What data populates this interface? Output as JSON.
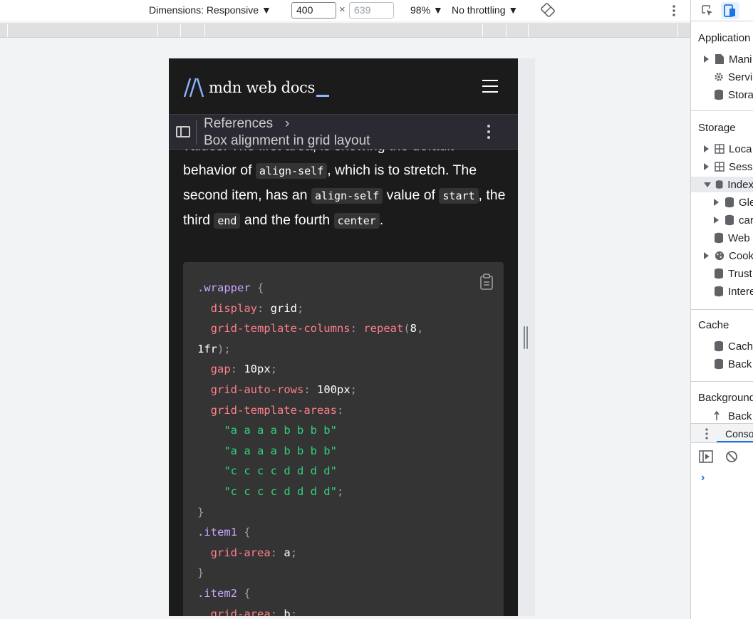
{
  "device_toolbar": {
    "dimensions_label": "Dimensions: Responsive ▼",
    "width_value": "400",
    "times": "×",
    "height_placeholder": "639",
    "zoom": "98% ▼",
    "throttling": "No throttling ▼"
  },
  "mdn": {
    "logo_text": "mdn web docs",
    "breadcrumb_parent": "References",
    "breadcrumb_chevron": "›",
    "breadcrumb_page": "Box alignment in grid layout"
  },
  "article": {
    "para_prefix": "values. The first area, is showing the default behavior of ",
    "code1": "align-self",
    "para_mid1": ", which is to stretch. The second item, has an ",
    "code2": "align-self",
    "para_mid2": " value of ",
    "code3": "start",
    "para_mid3": ", the third ",
    "code4": "end",
    "para_mid4": " and the fourth ",
    "code5": "center",
    "para_end": "."
  },
  "code_block": {
    "lines": [
      ".wrapper {",
      "  display: grid;",
      "  grid-template-columns: repeat(8,",
      "1fr);",
      "  gap: 10px;",
      "  grid-auto-rows: 100px;",
      "  grid-template-areas:",
      "    \"a a a a b b b b\"",
      "    \"a a a a b b b b\"",
      "    \"c c c c d d d d\"",
      "    \"c c c c d d d d\";",
      "}",
      ".item1 {",
      "  grid-area: a;",
      "}",
      ".item2 {",
      "  grid-area: b;"
    ]
  },
  "devtools": {
    "application_header": "Application",
    "app_items": [
      "Mani",
      "Servi",
      "Stora"
    ],
    "storage_header": "Storage",
    "storage_items": [
      "Loca",
      "Sess",
      "Index",
      "Gle",
      "car",
      "Web",
      "Cook",
      "Trust",
      "Intere"
    ],
    "cache_header": "Cache",
    "cache_items": [
      "Cach",
      "Back"
    ],
    "background_header": "Background",
    "background_items": [
      "Back"
    ],
    "console_tab": "Conso",
    "console_prompt": "›"
  }
}
